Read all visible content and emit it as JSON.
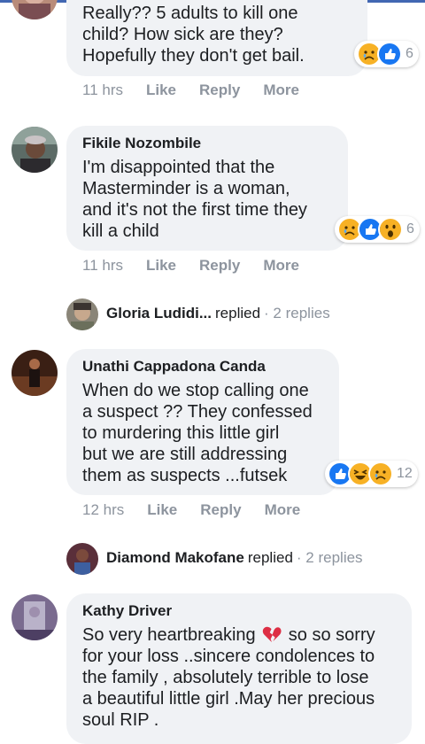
{
  "comments": [
    {
      "name": "",
      "lines": [
        "Really?? 5 adults to kill one",
        "child? How sick are they?",
        "Hopefully they don't get bail."
      ],
      "reaction_count": "6",
      "time": "11 hrs",
      "like": "Like",
      "reply": "Reply",
      "more": "More"
    },
    {
      "name": "Fikile Nozombile",
      "lines": [
        "I'm disappointed that the",
        "Masterminder is a woman,",
        "and it's not the first time they",
        "kill a child"
      ],
      "reaction_count": "6",
      "time": "11 hrs",
      "like": "Like",
      "reply": "Reply",
      "more": "More",
      "replies": {
        "name": "Gloria Ludidi...",
        "verb": "replied",
        "count": "· 2 replies"
      }
    },
    {
      "name": "Unathi Cappadona Canda",
      "lines": [
        "When do we stop calling one",
        "a suspect ?? They confessed",
        "to murdering this little girl",
        "but we are still addressing",
        "them as suspects ...futsek"
      ],
      "reaction_count": "12",
      "time": "12 hrs",
      "like": "Like",
      "reply": "Reply",
      "more": "More",
      "replies": {
        "name": "Diamond Makofane",
        "verb": "replied",
        "count": "· 2 replies"
      }
    },
    {
      "name": "Kathy Driver",
      "lines": [
        "So very heartbreaking",
        "for your loss ..sincere condolences to",
        "the family , absolutely terrible to lose",
        "a beautiful little girl .May her precious",
        "soul RIP ."
      ],
      "heart_emoji": "broken-heart",
      "after_emoji": "so so sorry"
    }
  ],
  "colors": {
    "like_blue": "#1877f2",
    "reaction_yellow": "#f7b125",
    "meta_gray": "#8d949e",
    "bubble": "#f0f2f5"
  }
}
